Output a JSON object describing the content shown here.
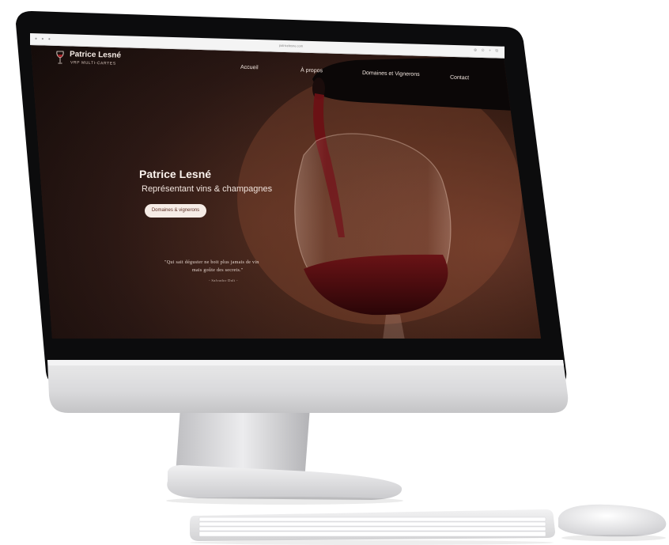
{
  "browser": {
    "url": "patricelesne.com",
    "window_dots": "● ● ●",
    "tool_icons": "⊕ ⊙ + ⧉"
  },
  "site": {
    "title": "Patrice Lesné",
    "subtitle": "VRP MULTI-CARTES"
  },
  "nav": {
    "items": [
      "Accueil",
      "À propos",
      "Domaines et Vignerons",
      "Contact"
    ]
  },
  "hero": {
    "title": "Patrice Lesné",
    "subtitle": "Représentant vins & champagnes",
    "cta_label": "Domaines & vignerons"
  },
  "quote": {
    "line1": "\"Qui sait déguster ne boit plus jamais de vin",
    "line2": "mais goûte des secrets.\"",
    "author": "- Salvador Dali -"
  },
  "colors": {
    "hero_text": "#fbf3ee",
    "button_bg": "#f6ece6",
    "button_text": "#5a2c22",
    "wine": "#5a0f12",
    "screen_bg": "#2a1410"
  }
}
